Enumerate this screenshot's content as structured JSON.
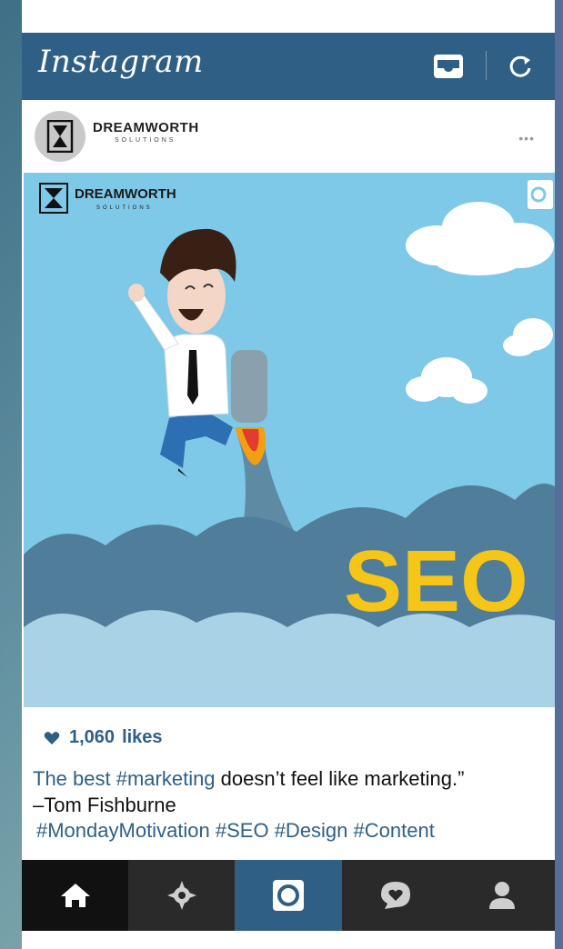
{
  "app": {
    "title": "Instagram"
  },
  "header": {
    "inbox_icon": "inbox-icon",
    "refresh_icon": "refresh-icon"
  },
  "post": {
    "account_name": "DREAMWORTH",
    "account_sub": "SOLUTIONS",
    "more": "•••",
    "image": {
      "logo_name": "DREAMWORTH",
      "logo_sub": "SOLUTIONS",
      "headline": "SEO"
    },
    "likes_count": "1,060",
    "likes_label": "likes",
    "caption_highlight": "The best #marketing",
    "caption_rest": " doesn’t feel like marketing.”",
    "caption_author": "–Tom Fishburne",
    "hashtags": "#MondayMotivation #SEO #Design #Content"
  },
  "tabbar": {
    "tabs": [
      {
        "name": "home",
        "icon": "home-icon"
      },
      {
        "name": "explore",
        "icon": "explore-icon"
      },
      {
        "name": "camera",
        "icon": "camera-icon"
      },
      {
        "name": "activity",
        "icon": "activity-icon"
      },
      {
        "name": "profile",
        "icon": "profile-icon"
      }
    ]
  },
  "colors": {
    "brand": "#2f5f85",
    "sky": "#7ec8e8",
    "seo": "#f5c518"
  }
}
